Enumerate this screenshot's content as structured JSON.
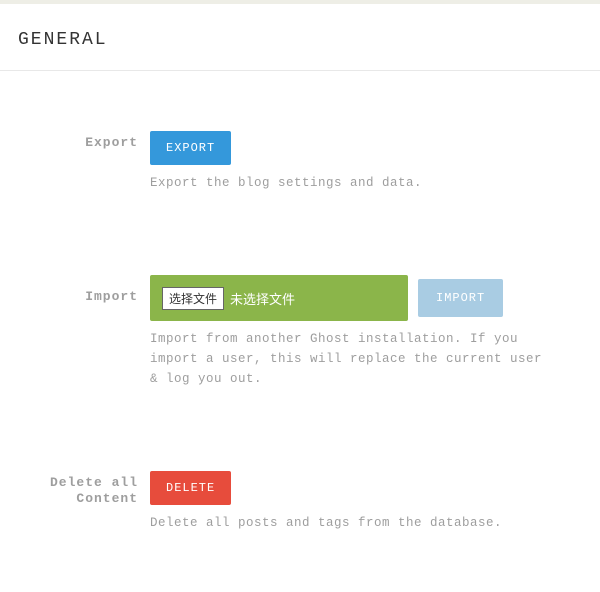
{
  "header": {
    "title": "GENERAL"
  },
  "export": {
    "label": "Export",
    "button": "EXPORT",
    "desc": "Export the blog settings and data."
  },
  "import": {
    "label": "Import",
    "file_button": "选择文件",
    "file_status": "未选择文件",
    "submit": "IMPORT",
    "desc": "Import from another Ghost installation. If you import a user, this will replace the current user & log you out."
  },
  "delete": {
    "label": "Delete all Content",
    "button": "DELETE",
    "desc": "Delete all posts and tags from the database."
  }
}
